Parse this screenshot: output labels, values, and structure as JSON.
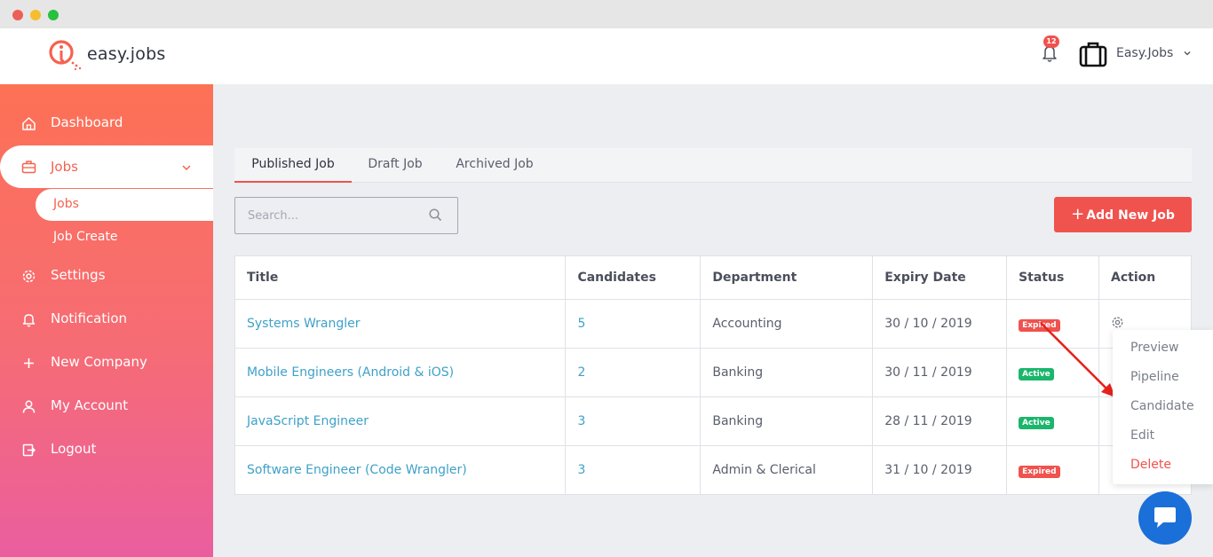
{
  "header": {
    "logo_text": "easy.jobs",
    "notification_count": "12",
    "company_name": "Easy.Jobs"
  },
  "sidebar": {
    "items": [
      {
        "label": "Dashboard",
        "icon": "home-icon"
      },
      {
        "label": "Jobs",
        "icon": "briefcase-icon",
        "active": true
      },
      {
        "label": "Settings",
        "icon": "gear-icon"
      },
      {
        "label": "Notification",
        "icon": "bell-icon"
      },
      {
        "label": "New Company",
        "icon": "plus-icon"
      },
      {
        "label": "My Account",
        "icon": "user-icon"
      },
      {
        "label": "Logout",
        "icon": "logout-icon"
      }
    ],
    "sub_items": [
      {
        "label": "Jobs",
        "active": true
      },
      {
        "label": "Job Create"
      }
    ]
  },
  "tabs": [
    {
      "label": "Published Job",
      "active": true
    },
    {
      "label": "Draft Job"
    },
    {
      "label": "Archived Job"
    }
  ],
  "search": {
    "placeholder": "Search..."
  },
  "add_button": {
    "plus": "+",
    "label": "Add New Job"
  },
  "table": {
    "columns": [
      "Title",
      "Candidates",
      "Department",
      "Expiry Date",
      "Status",
      "Action"
    ],
    "rows": [
      {
        "title": "Systems Wrangler",
        "candidates": "5",
        "department": "Accounting",
        "expiry": "30 / 10 / 2019",
        "status": "Expired"
      },
      {
        "title": "Mobile Engineers (Android & iOS)",
        "candidates": "2",
        "department": "Banking",
        "expiry": "30 / 11 / 2019",
        "status": "Active"
      },
      {
        "title": "JavaScript Engineer",
        "candidates": "3",
        "department": "Banking",
        "expiry": "28 / 11 / 2019",
        "status": "Active"
      },
      {
        "title": "Software Engineer (Code Wrangler)",
        "candidates": "3",
        "department": "Admin & Clerical",
        "expiry": "31 / 10 / 2019",
        "status": "Expired"
      }
    ]
  },
  "action_menu": {
    "items": [
      "Preview",
      "Pipeline",
      "Candidate",
      "Edit",
      "Delete"
    ]
  },
  "colors": {
    "accent": "#f0524e",
    "link": "#3ea1c8",
    "active_badge": "#1bb66c",
    "chat": "#1a6fd8"
  }
}
